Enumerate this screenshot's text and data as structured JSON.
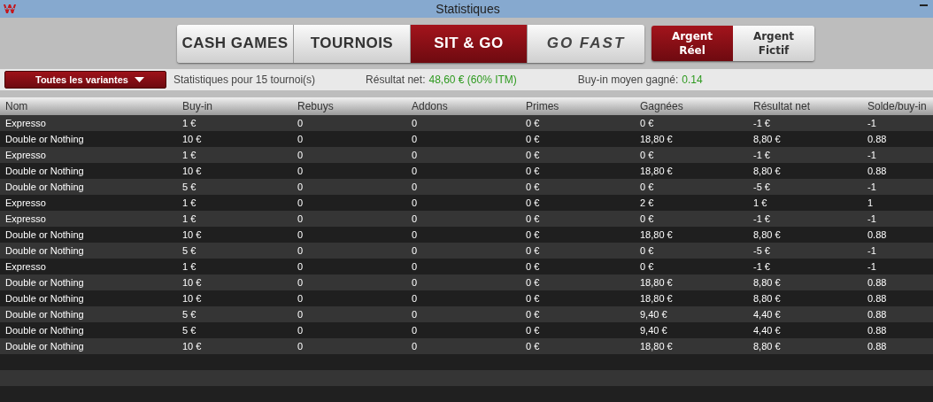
{
  "window": {
    "title": "Statistiques"
  },
  "game_tabs": [
    {
      "label": "CASH GAMES",
      "selected": false,
      "kind": "text"
    },
    {
      "label": "TOURNOIS",
      "selected": false,
      "kind": "text"
    },
    {
      "label": "SIT & GO",
      "selected": true,
      "kind": "text"
    },
    {
      "label": "GO FAST",
      "selected": false,
      "kind": "logo"
    }
  ],
  "money_tabs": [
    {
      "label": "Argent Réel",
      "selected": true
    },
    {
      "label": "Argent Fictif",
      "selected": false
    }
  ],
  "filter": {
    "value": "Toutes les variantes"
  },
  "summary": {
    "count": "Statistiques pour 15 tournoi(s)",
    "net_label": "Résultat net:",
    "net_value": "48,60 € (60% ITM)",
    "avg_label": "Buy-in moyen gagné:",
    "avg_value": "0.14"
  },
  "table": {
    "columns": [
      "Nom",
      "Buy-in",
      "Rebuys",
      "Addons",
      "Primes",
      "Gagnées",
      "Résultat net",
      "Solde/buy-in"
    ],
    "rows": [
      [
        "Expresso",
        "1 €",
        "0",
        "0",
        "0 €",
        "0 €",
        "-1 €",
        "-1"
      ],
      [
        "Double or Nothing",
        "10 €",
        "0",
        "0",
        "0 €",
        "18,80 €",
        "8,80 €",
        "0.88"
      ],
      [
        "Expresso",
        "1 €",
        "0",
        "0",
        "0 €",
        "0 €",
        "-1 €",
        "-1"
      ],
      [
        "Double or Nothing",
        "10 €",
        "0",
        "0",
        "0 €",
        "18,80 €",
        "8,80 €",
        "0.88"
      ],
      [
        "Double or Nothing",
        "5 €",
        "0",
        "0",
        "0 €",
        "0 €",
        "-5 €",
        "-1"
      ],
      [
        "Expresso",
        "1 €",
        "0",
        "0",
        "0 €",
        "2 €",
        "1 €",
        "1"
      ],
      [
        "Expresso",
        "1 €",
        "0",
        "0",
        "0 €",
        "0 €",
        "-1 €",
        "-1"
      ],
      [
        "Double or Nothing",
        "10 €",
        "0",
        "0",
        "0 €",
        "18,80 €",
        "8,80 €",
        "0.88"
      ],
      [
        "Double or Nothing",
        "5 €",
        "0",
        "0",
        "0 €",
        "0 €",
        "-5 €",
        "-1"
      ],
      [
        "Expresso",
        "1 €",
        "0",
        "0",
        "0 €",
        "0 €",
        "-1 €",
        "-1"
      ],
      [
        "Double or Nothing",
        "10 €",
        "0",
        "0",
        "0 €",
        "18,80 €",
        "8,80 €",
        "0.88"
      ],
      [
        "Double or Nothing",
        "10 €",
        "0",
        "0",
        "0 €",
        "18,80 €",
        "8,80 €",
        "0.88"
      ],
      [
        "Double or Nothing",
        "5 €",
        "0",
        "0",
        "0 €",
        "9,40 €",
        "4,40 €",
        "0.88"
      ],
      [
        "Double or Nothing",
        "5 €",
        "0",
        "0",
        "0 €",
        "9,40 €",
        "4,40 €",
        "0.88"
      ],
      [
        "Double or Nothing",
        "10 €",
        "0",
        "0",
        "0 €",
        "18,80 €",
        "8,80 €",
        "0.88"
      ]
    ]
  }
}
